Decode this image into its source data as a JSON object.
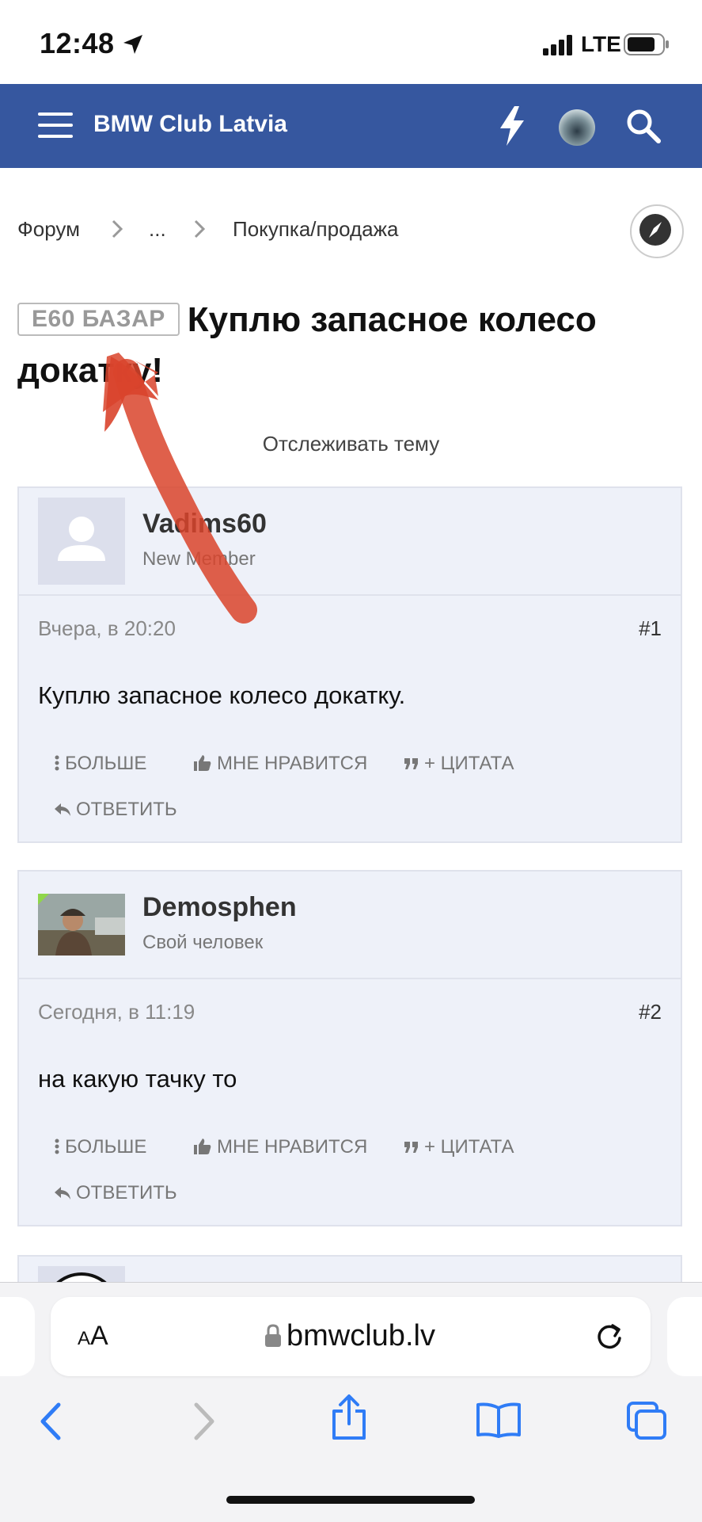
{
  "status_bar": {
    "time": "12:48",
    "network": "LTE"
  },
  "header": {
    "title": "BMW Club Latvia"
  },
  "breadcrumb": {
    "items": [
      "Форум",
      "...",
      "Покупка/продажа"
    ]
  },
  "thread": {
    "prefix": "E60 БАЗАР",
    "title": "Куплю запасное колесо докатку!",
    "watch_label": "Отслеживать тему"
  },
  "actions": {
    "more": "БОЛЬШЕ",
    "like": "МНЕ НРАВИТСЯ",
    "quote": "+ ЦИТАТА",
    "reply": "ОТВЕТИТЬ"
  },
  "posts": [
    {
      "author": "Vadims60",
      "user_title": "New Member",
      "date": "Вчера, в 20:20",
      "number": "#1",
      "text": "Куплю запасное колесо докатку."
    },
    {
      "author": "Demosphen",
      "user_title": "Свой человек",
      "date": "Сегодня, в 11:19",
      "number": "#2",
      "text": "на какую тачку то"
    }
  ],
  "browser": {
    "aa_small": "A",
    "aa_large": "A",
    "url": "bmwclub.lv"
  },
  "colors": {
    "header_bg": "#36579f",
    "post_bg": "#eef1f9",
    "link_blue": "#2f7cf6",
    "annotation_red": "#d9442c"
  }
}
